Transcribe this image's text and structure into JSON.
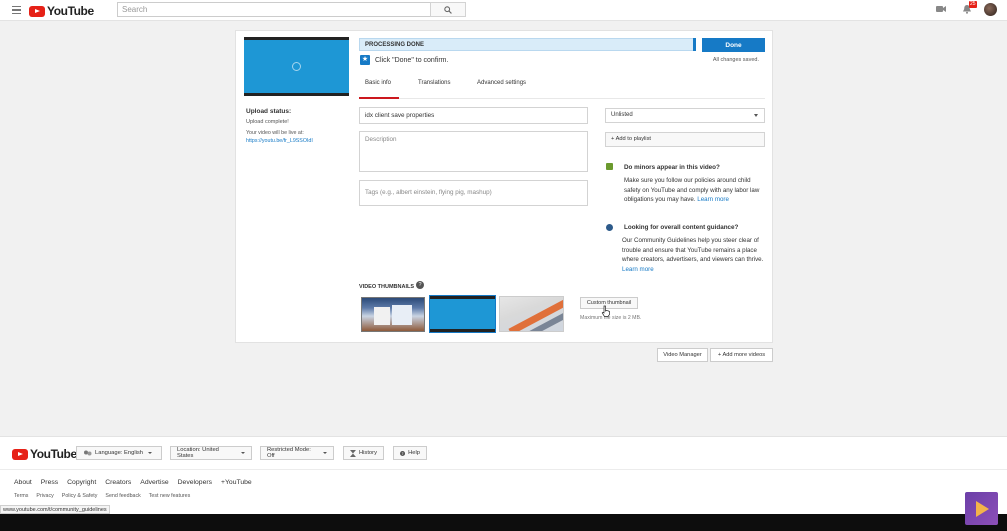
{
  "header": {
    "logo_text": "YouTube",
    "search_placeholder": "Search",
    "notification_count": "25"
  },
  "editor": {
    "processing_status": "PROCESSING DONE",
    "done_label": "Done",
    "saved_status": "All changes saved.",
    "confirm_text": "Click \"Done\" to confirm.",
    "tabs": [
      {
        "label": "Basic info"
      },
      {
        "label": "Translations"
      },
      {
        "label": "Advanced settings"
      }
    ],
    "upload_status_label": "Upload status:",
    "upload_complete": "Upload complete!",
    "live_at": "Your video will be live at:",
    "video_url": "https://youtu.be/fr_L9SSOIdI",
    "title_value": "idx client save properties",
    "description_placeholder": "Description",
    "tags_placeholder": "Tags (e.g., albert einstein, flying pig, mashup)",
    "privacy_value": "Unlisted",
    "playlist_label": "+ Add to playlist",
    "minors": {
      "title": "Do minors appear in this video?",
      "body": "Make sure you follow our policies around child safety on YouTube and comply with any labor law obligations you may have.",
      "link": "Learn more"
    },
    "guidance": {
      "title": "Looking for overall content guidance?",
      "body": "Our Community Guidelines help you steer clear of trouble and ensure that YouTube remains a place where creators, advertisers, and viewers can thrive.",
      "link": "Learn more"
    },
    "thumbnails_label": "VIDEO THUMBNAILS",
    "custom_thumbnail_label": "Custom thumbnail",
    "max_size": "Maximum file size is 2 MB.",
    "video_manager_label": "Video Manager",
    "add_more_label": "+ Add more videos"
  },
  "footer": {
    "logo_text": "YouTube",
    "language": "Language: English",
    "location": "Location: United States",
    "restricted": "Restricted Mode: Off",
    "history": "History",
    "help": "Help",
    "links_primary": [
      "About",
      "Press",
      "Copyright",
      "Creators",
      "Advertise",
      "Developers",
      "+YouTube"
    ],
    "links_secondary": [
      "Terms",
      "Privacy",
      "Policy & Safety",
      "Send feedback",
      "Test new features"
    ],
    "status_url": "www.youtube.com/t/community_guidelines"
  },
  "colors": {
    "brand_red": "#e62117",
    "accent_blue": "#167ac6",
    "thumbnail_blue": "#1e97d5"
  }
}
